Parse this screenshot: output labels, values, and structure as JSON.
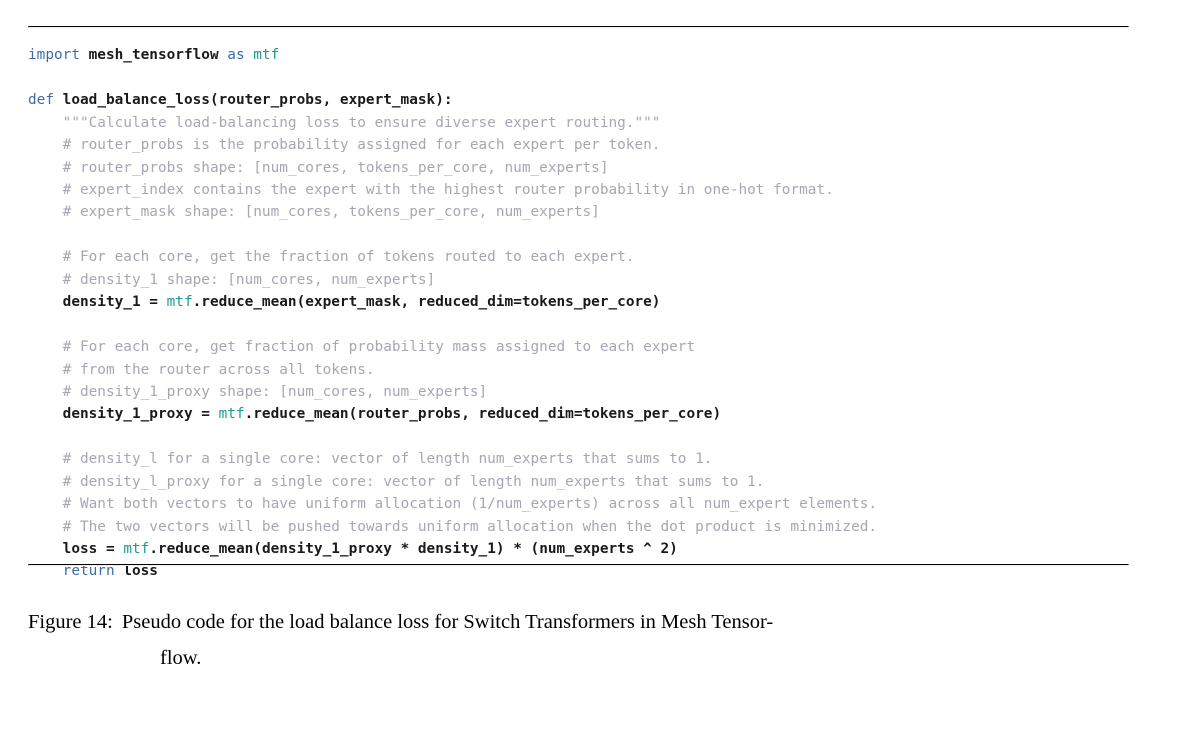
{
  "figure": {
    "label": "Figure 14:",
    "caption_line1": "Pseudo code for the load balance loss for Switch Transformers in Mesh Tensor-",
    "caption_line2": "flow.",
    "caption_full": "Figure 14: Pseudo code for the load balance loss for Switch Transformers in Mesh Tensorflow.",
    "rule_color": "#000000"
  },
  "syntax_colors": {
    "keyword": "#3b6ea5",
    "module": "#1f9a92",
    "comment": "#a7a7b4",
    "plain": "#1a1a1a",
    "background": "#ffffff"
  },
  "code": {
    "language": "python",
    "lines": [
      {
        "n": 1,
        "indent": 0,
        "tokens": [
          {
            "t": "kw",
            "s": "import"
          },
          {
            "t": "pl",
            "s": " mesh_tensorflow "
          },
          {
            "t": "kw",
            "s": "as"
          },
          {
            "t": "pl",
            "s": " "
          },
          {
            "t": "mod",
            "s": "mtf"
          }
        ]
      },
      {
        "n": 2,
        "indent": 0,
        "tokens": []
      },
      {
        "n": 3,
        "indent": 0,
        "tokens": [
          {
            "t": "kw",
            "s": "def"
          },
          {
            "t": "pl",
            "s": " load_balance_loss(router_probs, expert_mask):"
          }
        ]
      },
      {
        "n": 4,
        "indent": 1,
        "tokens": [
          {
            "t": "cm",
            "s": "\"\"\"Calculate load-balancing loss to ensure diverse expert routing.\"\"\""
          }
        ]
      },
      {
        "n": 5,
        "indent": 1,
        "tokens": [
          {
            "t": "cm",
            "s": "# router_probs is the probability assigned for each expert per token."
          }
        ]
      },
      {
        "n": 6,
        "indent": 1,
        "tokens": [
          {
            "t": "cm",
            "s": "# router_probs shape: [num_cores, tokens_per_core, num_experts]"
          }
        ]
      },
      {
        "n": 7,
        "indent": 1,
        "tokens": [
          {
            "t": "cm",
            "s": "# expert_index contains the expert with the highest router probability in one-hot format."
          }
        ]
      },
      {
        "n": 8,
        "indent": 1,
        "tokens": [
          {
            "t": "cm",
            "s": "# expert_mask shape: [num_cores, tokens_per_core, num_experts]"
          }
        ]
      },
      {
        "n": 9,
        "indent": 0,
        "tokens": []
      },
      {
        "n": 10,
        "indent": 1,
        "tokens": [
          {
            "t": "cm",
            "s": "# For each core, get the fraction of tokens routed to each expert."
          }
        ]
      },
      {
        "n": 11,
        "indent": 1,
        "tokens": [
          {
            "t": "cm",
            "s": "# density_1 shape: [num_cores, num_experts]"
          }
        ]
      },
      {
        "n": 12,
        "indent": 1,
        "tokens": [
          {
            "t": "pl",
            "s": "density_1 = "
          },
          {
            "t": "mod",
            "s": "mtf"
          },
          {
            "t": "pl",
            "s": ".reduce_mean(expert_mask, reduced_dim=tokens_per_core)"
          }
        ]
      },
      {
        "n": 13,
        "indent": 0,
        "tokens": []
      },
      {
        "n": 14,
        "indent": 1,
        "tokens": [
          {
            "t": "cm",
            "s": "# For each core, get fraction of probability mass assigned to each expert"
          }
        ]
      },
      {
        "n": 15,
        "indent": 1,
        "tokens": [
          {
            "t": "cm",
            "s": "# from the router across all tokens."
          }
        ]
      },
      {
        "n": 16,
        "indent": 1,
        "tokens": [
          {
            "t": "cm",
            "s": "# density_1_proxy shape: [num_cores, num_experts]"
          }
        ]
      },
      {
        "n": 17,
        "indent": 1,
        "tokens": [
          {
            "t": "pl",
            "s": "density_1_proxy = "
          },
          {
            "t": "mod",
            "s": "mtf"
          },
          {
            "t": "pl",
            "s": ".reduce_mean(router_probs, reduced_dim=tokens_per_core)"
          }
        ]
      },
      {
        "n": 18,
        "indent": 0,
        "tokens": []
      },
      {
        "n": 19,
        "indent": 1,
        "tokens": [
          {
            "t": "cm",
            "s": "# density_l for a single core: vector of length num_experts that sums to 1."
          }
        ]
      },
      {
        "n": 20,
        "indent": 1,
        "tokens": [
          {
            "t": "cm",
            "s": "# density_l_proxy for a single core: vector of length num_experts that sums to 1."
          }
        ]
      },
      {
        "n": 21,
        "indent": 1,
        "tokens": [
          {
            "t": "cm",
            "s": "# Want both vectors to have uniform allocation (1/num_experts) across all num_expert elements."
          }
        ]
      },
      {
        "n": 22,
        "indent": 1,
        "tokens": [
          {
            "t": "cm",
            "s": "# The two vectors will be pushed towards uniform allocation when the dot product is minimized."
          }
        ]
      },
      {
        "n": 23,
        "indent": 1,
        "tokens": [
          {
            "t": "pl",
            "s": "loss = "
          },
          {
            "t": "mod",
            "s": "mtf"
          },
          {
            "t": "pl",
            "s": ".reduce_mean(density_1_proxy * density_1) * (num_experts ^ 2)"
          }
        ]
      },
      {
        "n": 24,
        "indent": 1,
        "tokens": [
          {
            "t": "kw",
            "s": "return"
          },
          {
            "t": "pl",
            "s": " loss"
          }
        ]
      }
    ]
  }
}
